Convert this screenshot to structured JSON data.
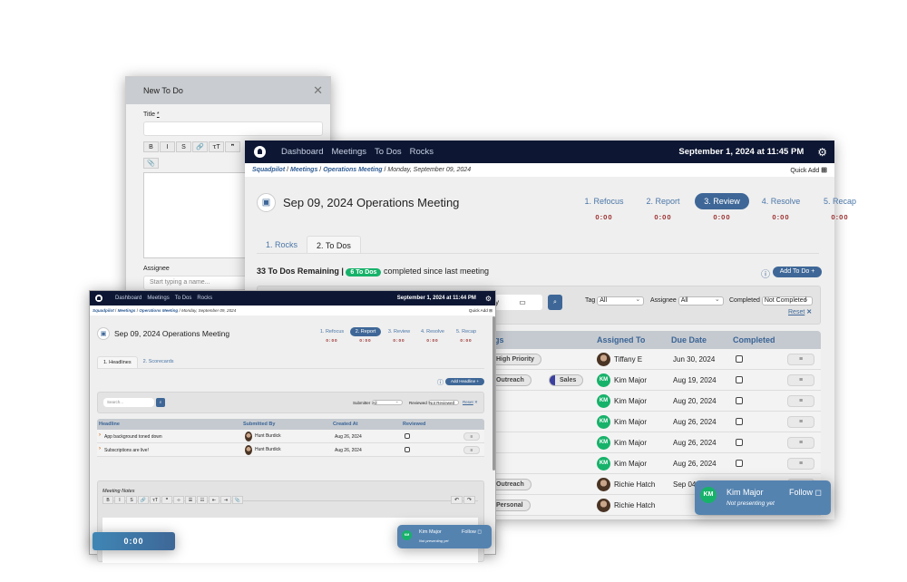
{
  "modal": {
    "title": "New To Do",
    "title_label": "Title",
    "required_mark": "*",
    "assignee_label": "Assignee",
    "assignee_placeholder": "Start typing a name...",
    "toolbar": [
      "B",
      "I",
      "S",
      "🔗",
      "ꚍT",
      "❞"
    ],
    "attach": "📎"
  },
  "todos_window": {
    "nav": {
      "items": [
        "Dashboard",
        "Meetings",
        "To Dos",
        "Rocks"
      ],
      "datetime": "September 1, 2024 at 11:45 PM"
    },
    "breadcrumb": {
      "items": [
        "Squadpilot",
        "Meetings",
        "Operations Meeting"
      ],
      "current": "Monday, September 09, 2024",
      "quick_add": "Quick Add"
    },
    "title": "Sep 09, 2024 Operations Meeting",
    "steps": [
      {
        "label": "1. Refocus",
        "timer": "0:00"
      },
      {
        "label": "2. Report",
        "timer": "0:00"
      },
      {
        "label": "3. Review",
        "timer": "0:00",
        "active": true
      },
      {
        "label": "4. Resolve",
        "timer": "0:00"
      },
      {
        "label": "5. Recap",
        "timer": "0:00"
      }
    ],
    "tabs": [
      "1. Rocks",
      "2. To Dos"
    ],
    "remaining": "33 To Dos Remaining |",
    "completed_badge": "6 To Dos",
    "completed_text": "completed since last meeting",
    "add_button": "Add To Do +",
    "filters": {
      "date_placeholder": "yyy",
      "tag_label": "Tag",
      "tag_value": "All",
      "assignee_label": "Assignee",
      "assignee_value": "All",
      "completed_label": "Completed",
      "completed_value": "Not Completed",
      "reset": "Reset"
    },
    "columns": [
      "ags",
      "Assigned To",
      "Due Date",
      "Completed"
    ],
    "rows": [
      {
        "tags": [
          {
            "name": "High Priority",
            "color": "#e0135a"
          }
        ],
        "assignee": "Tiffany E",
        "avatar": "photo",
        "due": "Jun 30, 2024"
      },
      {
        "tags": [
          {
            "name": "Outreach",
            "color": "#1530d8"
          },
          {
            "name": "Sales",
            "color": "#3b3f9e"
          }
        ],
        "assignee": "Kim Major",
        "avatar": "KM",
        "due": "Aug 19, 2024"
      },
      {
        "tags": [],
        "assignee": "Kim Major",
        "avatar": "KM",
        "due": "Aug 20, 2024"
      },
      {
        "tags": [],
        "assignee": "Kim Major",
        "avatar": "KM",
        "due": "Aug 26, 2024"
      },
      {
        "tags": [],
        "assignee": "Kim Major",
        "avatar": "KM",
        "due": "Aug 26, 2024"
      },
      {
        "tags": [],
        "assignee": "Kim Major",
        "avatar": "KM",
        "due": "Aug 26, 2024"
      },
      {
        "tags": [
          {
            "name": "Outreach",
            "color": "#1530d8"
          }
        ],
        "assignee": "Richie Hatch",
        "avatar": "photo",
        "due": "Sep 04"
      },
      {
        "tags": [
          {
            "name": "Personal",
            "color": "#3bbf9f"
          }
        ],
        "assignee": "Richie Hatch",
        "avatar": "photo",
        "due": ""
      }
    ],
    "presenter": {
      "initials": "KM",
      "name": "Kim Major",
      "follow": "Follow",
      "status": "Not presenting yet"
    }
  },
  "headlines_window": {
    "nav": {
      "items": [
        "Dashboard",
        "Meetings",
        "To Dos",
        "Rocks"
      ],
      "datetime": "September 1, 2024 at 11:44 PM"
    },
    "breadcrumb": {
      "items": [
        "Squadpilot",
        "Meetings",
        "Operations Meeting"
      ],
      "current": "Monday, September 09, 2024",
      "quick_add": "Quick Add"
    },
    "title": "Sep 09, 2024 Operations Meeting",
    "steps": [
      {
        "label": "1. Refocus",
        "timer": "0:00"
      },
      {
        "label": "2. Report",
        "timer": "0:00",
        "active": true
      },
      {
        "label": "3. Review",
        "timer": "0:00"
      },
      {
        "label": "4. Resolve",
        "timer": "0:00"
      },
      {
        "label": "5. Recap",
        "timer": "0:00"
      }
    ],
    "tabs": [
      "1. Headlines",
      "2. Scorecards"
    ],
    "add_button": "Add Headline +",
    "filters": {
      "search_placeholder": "Search...",
      "submitter_label": "Submitter",
      "submitter_value": "All",
      "reviewed_label": "Reviewed",
      "reviewed_value": "Not Reviewed",
      "reset": "Reset"
    },
    "columns": [
      "Headline",
      "Submitted By",
      "Created At",
      "Reviewed"
    ],
    "rows": [
      {
        "headline": "App background toned down",
        "by": "Hunt Burdick",
        "created": "Aug 26, 2024"
      },
      {
        "headline": "Subscriptions are live!",
        "by": "Hunt Burdick",
        "created": "Aug 26, 2024"
      }
    ],
    "notes_label": "Meeting Notes",
    "notes_toolbar": [
      "B",
      "I",
      "S",
      "🔗",
      "ꚍT",
      "❞",
      "‹›",
      "☰",
      "☷",
      "⇤",
      "⇥",
      "📎"
    ],
    "undo": "↶",
    "redo": "↷",
    "presenter": {
      "initials": "KM",
      "name": "Kim Major",
      "follow": "Follow",
      "status": "Not presenting yet"
    },
    "timer": "0:00"
  },
  "colors": {
    "nav": "#0d1733",
    "accent": "#3e6797",
    "success": "#17b26a",
    "timer": "#9b2d2d"
  }
}
